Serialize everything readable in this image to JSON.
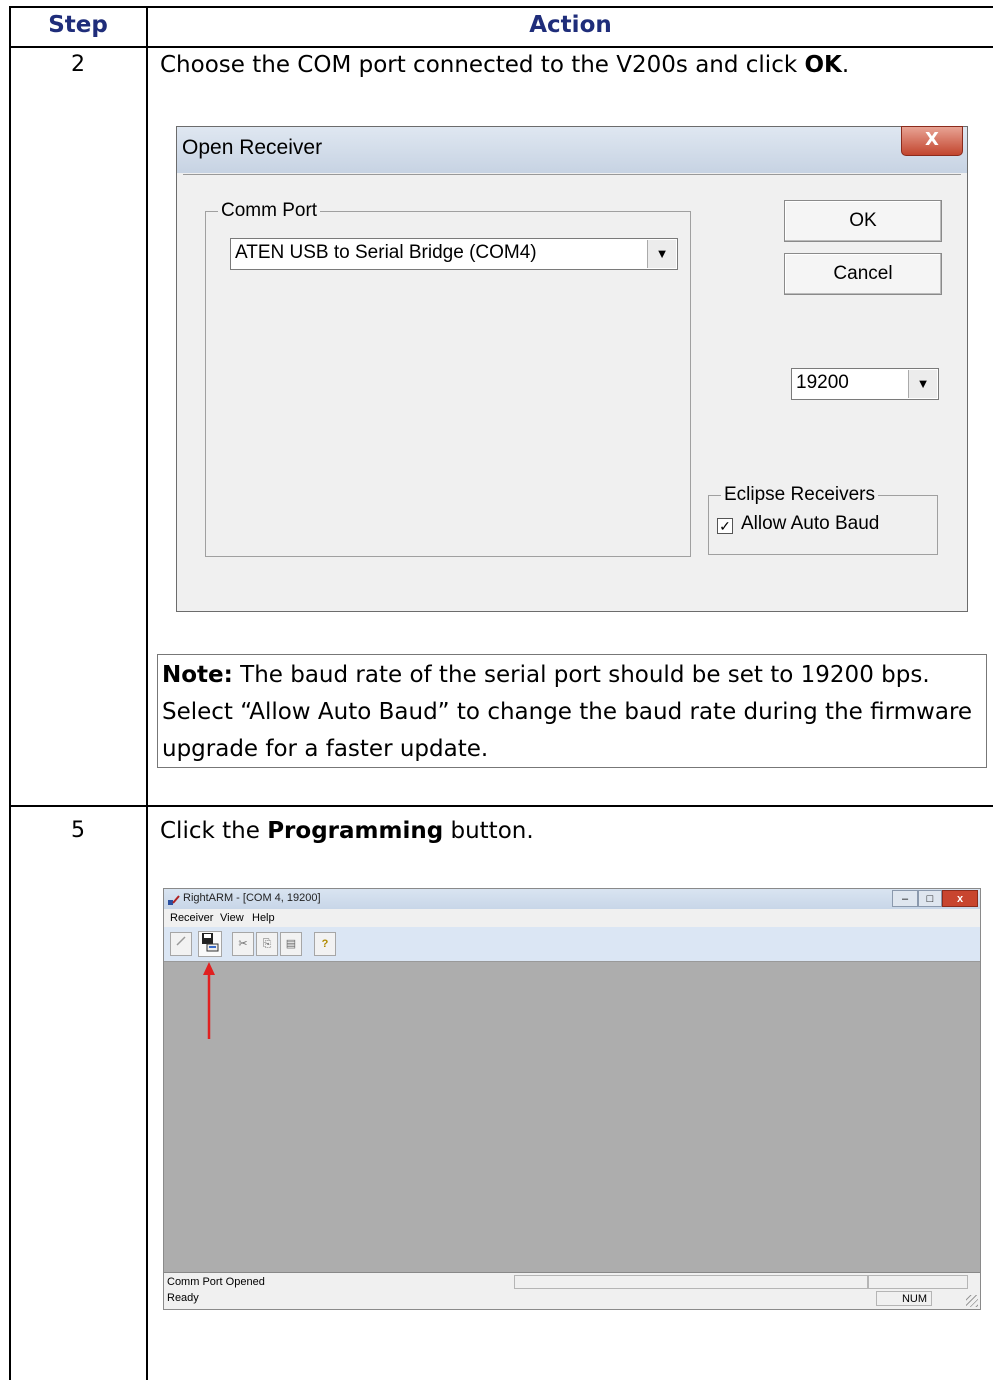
{
  "table": {
    "col_step": "Step",
    "col_action": "Action",
    "rows": [
      {
        "step": "2",
        "instruction_pre": "Choose the COM port connected to the V200s and click ",
        "instruction_bold": "OK",
        "instruction_post": "."
      },
      {
        "step": "5",
        "instruction_pre": "Click the ",
        "instruction_bold": "Programming",
        "instruction_post": " button."
      }
    ]
  },
  "dialog": {
    "title": "Open Receiver",
    "close_glyph": "X",
    "comm_port_label": "Comm Port",
    "comm_port_value": "ATEN USB to Serial Bridge (COM4)",
    "ok_label": "OK",
    "cancel_label": "Cancel",
    "baud_value": "19200",
    "eclipse_label": "Eclipse Receivers",
    "auto_baud_label": "Allow Auto Baud",
    "auto_baud_checked": "✓"
  },
  "note": {
    "label": "Note:",
    "text": " The baud rate of the serial port should be set to 19200 bps. Select “Allow Auto Baud” to change the baud rate during the firmware upgrade for a faster update."
  },
  "rightarm": {
    "title": "RightARM - [COM 4, 19200]",
    "menu": [
      "Receiver",
      "View",
      "Help"
    ],
    "status_line1": "Comm Port Opened",
    "status_line2": "Ready",
    "num_indicator": "NUM",
    "arrow_color": "#e02020"
  }
}
